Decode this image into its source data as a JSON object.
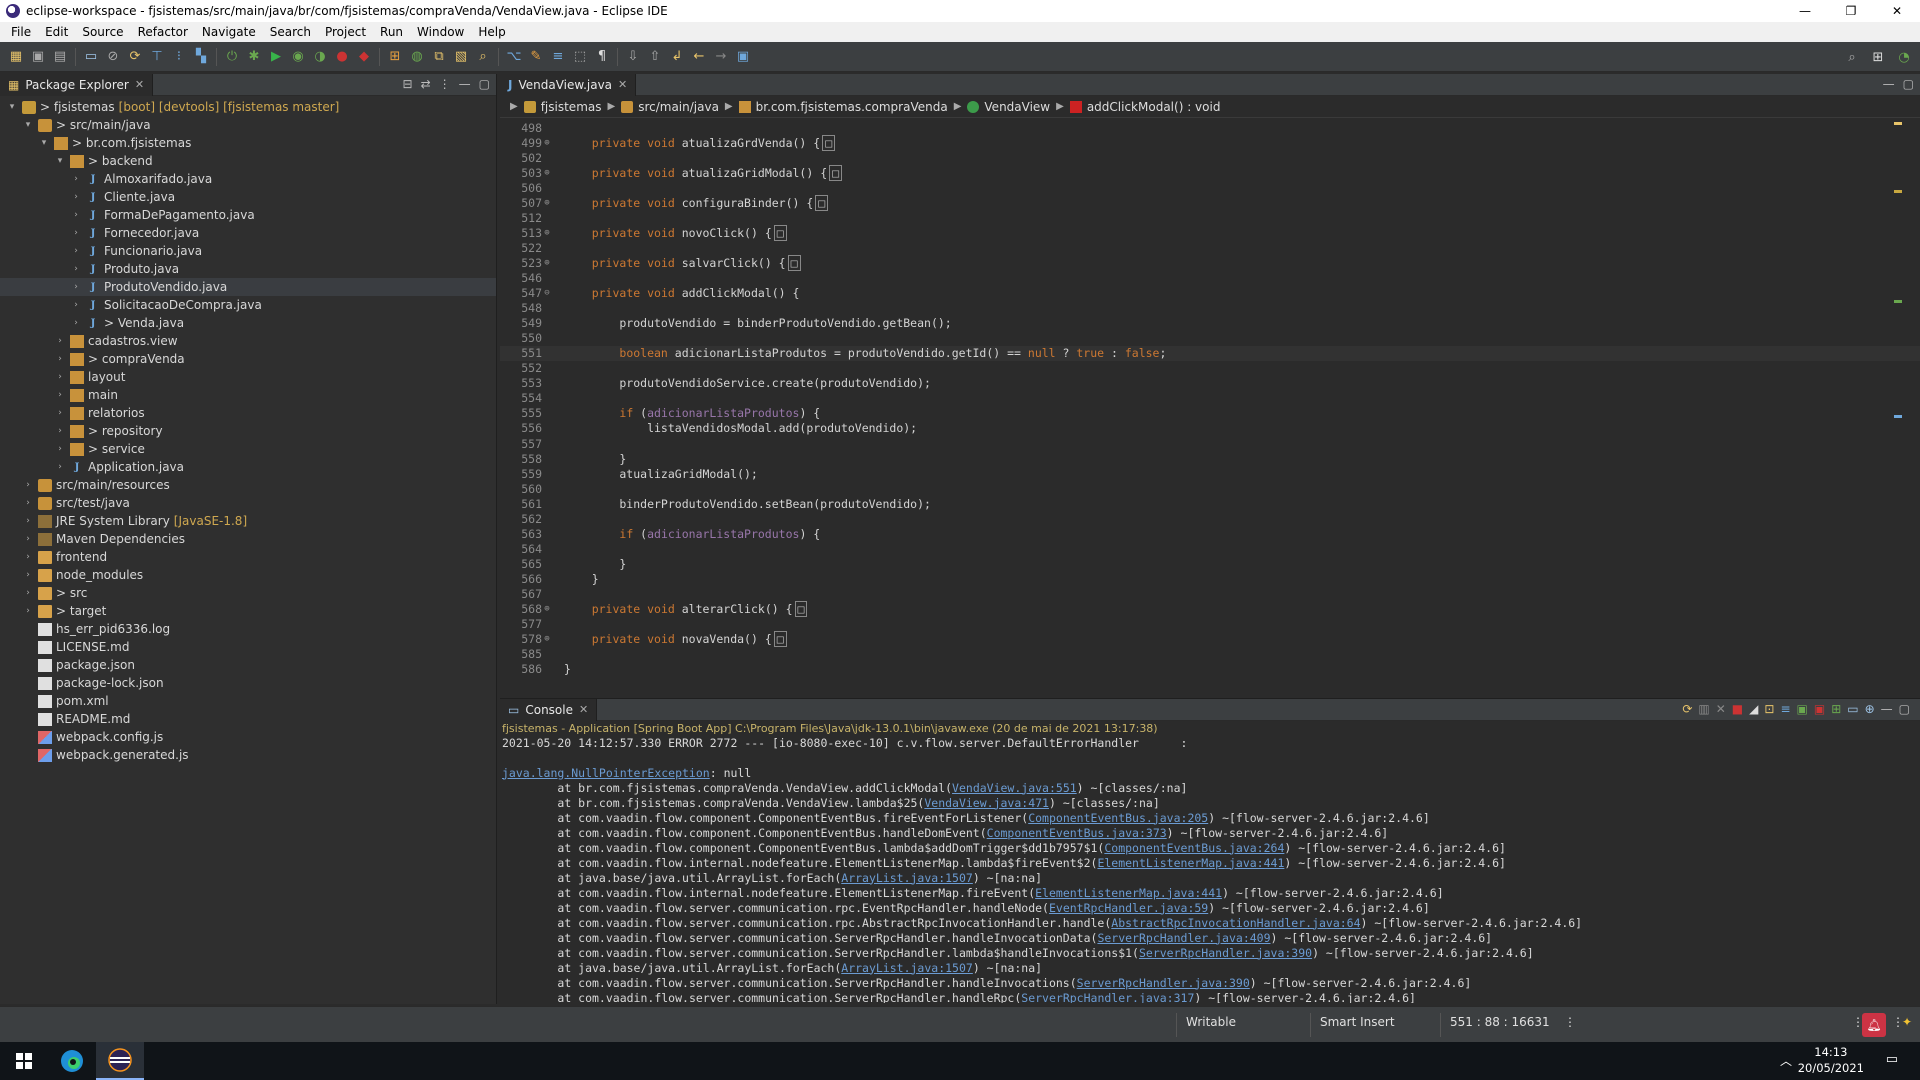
{
  "window": {
    "title": "eclipse-workspace - fjsistemas/src/main/java/br/com/fjsistemas/compraVenda/VendaView.java - Eclipse IDE",
    "controls": [
      "—",
      "❐",
      "✕"
    ]
  },
  "menu": [
    "File",
    "Edit",
    "Source",
    "Refactor",
    "Navigate",
    "Search",
    "Project",
    "Run",
    "Window",
    "Help"
  ],
  "explorer": {
    "tab_label": "Package Explorer",
    "tree": [
      {
        "depth": 0,
        "twisty": "▾",
        "icon": "project",
        "label": "> fjsistemas",
        "extra": "[boot] [devtools] [fjsistemas master]"
      },
      {
        "depth": 1,
        "twisty": "▾",
        "icon": "src",
        "label": "> src/main/java",
        "extra": ""
      },
      {
        "depth": 2,
        "twisty": "▾",
        "icon": "pkg",
        "label": "> br.com.fjsistemas",
        "extra": ""
      },
      {
        "depth": 3,
        "twisty": "▾",
        "icon": "pkg",
        "label": "> backend",
        "extra": ""
      },
      {
        "depth": 4,
        "twisty": "›",
        "icon": "java",
        "label": "Almoxarifado.java",
        "extra": ""
      },
      {
        "depth": 4,
        "twisty": "›",
        "icon": "java",
        "label": "Cliente.java",
        "extra": ""
      },
      {
        "depth": 4,
        "twisty": "›",
        "icon": "java",
        "label": "FormaDePagamento.java",
        "extra": ""
      },
      {
        "depth": 4,
        "twisty": "›",
        "icon": "java",
        "label": "Fornecedor.java",
        "extra": ""
      },
      {
        "depth": 4,
        "twisty": "›",
        "icon": "java",
        "label": "Funcionario.java",
        "extra": ""
      },
      {
        "depth": 4,
        "twisty": "›",
        "icon": "java",
        "label": "Produto.java",
        "extra": ""
      },
      {
        "depth": 4,
        "twisty": "›",
        "icon": "java",
        "label": "ProdutoVendido.java",
        "extra": "",
        "selected": true
      },
      {
        "depth": 4,
        "twisty": "›",
        "icon": "java",
        "label": "SolicitacaoDeCompra.java",
        "extra": ""
      },
      {
        "depth": 4,
        "twisty": "›",
        "icon": "java",
        "label": "> Venda.java",
        "extra": ""
      },
      {
        "depth": 3,
        "twisty": "›",
        "icon": "pkg",
        "label": "cadastros.view",
        "extra": ""
      },
      {
        "depth": 3,
        "twisty": "›",
        "icon": "pkg",
        "label": "> compraVenda",
        "extra": ""
      },
      {
        "depth": 3,
        "twisty": "›",
        "icon": "pkg",
        "label": "layout",
        "extra": ""
      },
      {
        "depth": 3,
        "twisty": "›",
        "icon": "pkg",
        "label": "main",
        "extra": ""
      },
      {
        "depth": 3,
        "twisty": "›",
        "icon": "pkg",
        "label": "relatorios",
        "extra": ""
      },
      {
        "depth": 3,
        "twisty": "›",
        "icon": "pkg",
        "label": "> repository",
        "extra": ""
      },
      {
        "depth": 3,
        "twisty": "›",
        "icon": "pkg",
        "label": "> service",
        "extra": ""
      },
      {
        "depth": 3,
        "twisty": "›",
        "icon": "java",
        "label": "Application.java",
        "extra": ""
      },
      {
        "depth": 1,
        "twisty": "›",
        "icon": "src",
        "label": "src/main/resources",
        "extra": ""
      },
      {
        "depth": 1,
        "twisty": "›",
        "icon": "src",
        "label": "src/test/java",
        "extra": ""
      },
      {
        "depth": 1,
        "twisty": "›",
        "icon": "lib",
        "label": "JRE System Library",
        "extra": "[JavaSE-1.8]"
      },
      {
        "depth": 1,
        "twisty": "›",
        "icon": "lib",
        "label": "Maven Dependencies",
        "extra": ""
      },
      {
        "depth": 1,
        "twisty": "›",
        "icon": "folder",
        "label": "frontend",
        "extra": ""
      },
      {
        "depth": 1,
        "twisty": "›",
        "icon": "folder",
        "label": "node_modules",
        "extra": ""
      },
      {
        "depth": 1,
        "twisty": "›",
        "icon": "folder",
        "label": "> src",
        "extra": ""
      },
      {
        "depth": 1,
        "twisty": "›",
        "icon": "folder",
        "label": "> target",
        "extra": ""
      },
      {
        "depth": 1,
        "twisty": "",
        "icon": "file",
        "label": "hs_err_pid6336.log",
        "extra": ""
      },
      {
        "depth": 1,
        "twisty": "",
        "icon": "file",
        "label": "LICENSE.md",
        "extra": ""
      },
      {
        "depth": 1,
        "twisty": "",
        "icon": "file",
        "label": "package.json",
        "extra": ""
      },
      {
        "depth": 1,
        "twisty": "",
        "icon": "file",
        "label": "package-lock.json",
        "extra": ""
      },
      {
        "depth": 1,
        "twisty": "",
        "icon": "file",
        "label": "pom.xml",
        "extra": ""
      },
      {
        "depth": 1,
        "twisty": "",
        "icon": "file",
        "label": "README.md",
        "extra": ""
      },
      {
        "depth": 1,
        "twisty": "",
        "icon": "web",
        "label": "webpack.config.js",
        "extra": ""
      },
      {
        "depth": 1,
        "twisty": "",
        "icon": "web",
        "label": "webpack.generated.js",
        "extra": ""
      }
    ]
  },
  "editor": {
    "tab_label": "VendaView.java",
    "breadcrumb": [
      "fjsistemas",
      "src/main/java",
      "br.com.fjsistemas.compraVenda",
      "VendaView",
      "addClickModal() : void"
    ],
    "lines": [
      {
        "n": "498",
        "fold": "",
        "code": ""
      },
      {
        "n": "499",
        "fold": "⊕",
        "code": "    <k>private</k> <k>void</k> atualizaGrdVenda() {<f>□</f>"
      },
      {
        "n": "502",
        "fold": "",
        "code": ""
      },
      {
        "n": "503",
        "fold": "⊕",
        "code": "    <k>private</k> <k>void</k> atualizaGridModal() {<f>□</f>"
      },
      {
        "n": "506",
        "fold": "",
        "code": ""
      },
      {
        "n": "507",
        "fold": "⊕",
        "code": "    <k>private</k> <k>void</k> configuraBinder() {<f>□</f>"
      },
      {
        "n": "512",
        "fold": "",
        "code": ""
      },
      {
        "n": "513",
        "fold": "⊕",
        "code": "    <k>private</k> <k>void</k> novoClick() {<f>□</f>"
      },
      {
        "n": "522",
        "fold": "",
        "code": ""
      },
      {
        "n": "523",
        "fold": "⊕",
        "code": "    <k>private</k> <k>void</k> salvarClick() {<f>□</f>"
      },
      {
        "n": "546",
        "fold": "",
        "code": ""
      },
      {
        "n": "547",
        "fold": "⊖",
        "code": "    <k>private</k> <k>void</k> addClickModal() {"
      },
      {
        "n": "548",
        "fold": "",
        "code": ""
      },
      {
        "n": "549",
        "fold": "",
        "code": "        produtoVendido = binderProdutoVendido.getBean();"
      },
      {
        "n": "550",
        "fold": "",
        "code": ""
      },
      {
        "n": "551",
        "fold": "",
        "code": "        <k>boolean</k> adicionarListaProdutos = produtoVendido.getId() == <k>null</k> ? <k>true</k> : <k>false</k>;",
        "current": true
      },
      {
        "n": "552",
        "fold": "",
        "code": ""
      },
      {
        "n": "553",
        "fold": "",
        "code": "        produtoVendidoService.create(produtoVendido);"
      },
      {
        "n": "554",
        "fold": "",
        "code": ""
      },
      {
        "n": "555",
        "fold": "",
        "code": "        <k>if</k> (<v>adicionarListaProdutos</v>) {"
      },
      {
        "n": "556",
        "fold": "",
        "code": "            listaVendidosModal.add(produtoVendido);"
      },
      {
        "n": "557",
        "fold": "",
        "code": ""
      },
      {
        "n": "558",
        "fold": "",
        "code": "        }"
      },
      {
        "n": "559",
        "fold": "",
        "code": "        atualizaGridModal();"
      },
      {
        "n": "560",
        "fold": "",
        "code": ""
      },
      {
        "n": "561",
        "fold": "",
        "code": "        binderProdutoVendido.setBean(produtoVendido);"
      },
      {
        "n": "562",
        "fold": "",
        "code": ""
      },
      {
        "n": "563",
        "fold": "",
        "code": "        <k>if</k> (<v>adicionarListaProdutos</v>) {"
      },
      {
        "n": "564",
        "fold": "",
        "code": ""
      },
      {
        "n": "565",
        "fold": "",
        "code": "        }"
      },
      {
        "n": "566",
        "fold": "",
        "code": "    }"
      },
      {
        "n": "567",
        "fold": "",
        "code": ""
      },
      {
        "n": "568",
        "fold": "⊕",
        "code": "    <k>private</k> <k>void</k> alterarClick() {<f>□</f>"
      },
      {
        "n": "577",
        "fold": "",
        "code": ""
      },
      {
        "n": "578",
        "fold": "⊕",
        "code": "    <k>private</k> <k>void</k> novaVenda() {<f>□</f>"
      },
      {
        "n": "585",
        "fold": "",
        "code": ""
      },
      {
        "n": "586",
        "fold": "",
        "code": "}"
      }
    ]
  },
  "console": {
    "tab_label": "Console",
    "launch_info": "fjsistemas - Application [Spring Boot App] C:\\Program Files\\Java\\jdk-13.0.1\\bin\\javaw.exe  (20 de mai de 2021 13:17:38)",
    "lines": [
      {
        "pre": "2021-05-20 14:12:57.330 ERROR 2772 --- [io-8080-exec-10] c.v.flow.server.DefaultErrorHandler      :",
        "link": "",
        "post": ""
      },
      {
        "pre": "",
        "link": "",
        "post": ""
      },
      {
        "pre": "",
        "link": "java.lang.NullPointerException",
        "post": ": null"
      },
      {
        "pre": "\tat br.com.fjsistemas.compraVenda.VendaView.addClickModal(",
        "link": "VendaView.java:551",
        "post": ") ~[classes/:na]"
      },
      {
        "pre": "\tat br.com.fjsistemas.compraVenda.VendaView.lambda$25(",
        "link": "VendaView.java:471",
        "post": ") ~[classes/:na]"
      },
      {
        "pre": "\tat com.vaadin.flow.component.ComponentEventBus.fireEventForListener(",
        "link": "ComponentEventBus.java:205",
        "post": ") ~[flow-server-2.4.6.jar:2.4.6]"
      },
      {
        "pre": "\tat com.vaadin.flow.component.ComponentEventBus.handleDomEvent(",
        "link": "ComponentEventBus.java:373",
        "post": ") ~[flow-server-2.4.6.jar:2.4.6]"
      },
      {
        "pre": "\tat com.vaadin.flow.component.ComponentEventBus.lambda$addDomTrigger$dd1b7957$1(",
        "link": "ComponentEventBus.java:264",
        "post": ") ~[flow-server-2.4.6.jar:2.4.6]"
      },
      {
        "pre": "\tat com.vaadin.flow.internal.nodefeature.ElementListenerMap.lambda$fireEvent$2(",
        "link": "ElementListenerMap.java:441",
        "post": ") ~[flow-server-2.4.6.jar:2.4.6]"
      },
      {
        "pre": "\tat java.base/java.util.ArrayList.forEach(",
        "link": "ArrayList.java:1507",
        "post": ") ~[na:na]"
      },
      {
        "pre": "\tat com.vaadin.flow.internal.nodefeature.ElementListenerMap.fireEvent(",
        "link": "ElementListenerMap.java:441",
        "post": ") ~[flow-server-2.4.6.jar:2.4.6]"
      },
      {
        "pre": "\tat com.vaadin.flow.server.communication.rpc.EventRpcHandler.handleNode(",
        "link": "EventRpcHandler.java:59",
        "post": ") ~[flow-server-2.4.6.jar:2.4.6]"
      },
      {
        "pre": "\tat com.vaadin.flow.server.communication.rpc.AbstractRpcInvocationHandler.handle(",
        "link": "AbstractRpcInvocationHandler.java:64",
        "post": ") ~[flow-server-2.4.6.jar:2.4.6]"
      },
      {
        "pre": "\tat com.vaadin.flow.server.communication.ServerRpcHandler.handleInvocationData(",
        "link": "ServerRpcHandler.java:409",
        "post": ") ~[flow-server-2.4.6.jar:2.4.6]"
      },
      {
        "pre": "\tat com.vaadin.flow.server.communication.ServerRpcHandler.lambda$handleInvocations$1(",
        "link": "ServerRpcHandler.java:390",
        "post": ") ~[flow-server-2.4.6.jar:2.4.6]"
      },
      {
        "pre": "\tat java.base/java.util.ArrayList.forEach(",
        "link": "ArrayList.java:1507",
        "post": ") ~[na:na]"
      },
      {
        "pre": "\tat com.vaadin.flow.server.communication.ServerRpcHandler.handleInvocations(",
        "link": "ServerRpcHandler.java:390",
        "post": ") ~[flow-server-2.4.6.jar:2.4.6]"
      },
      {
        "pre": "\tat com.vaadin.flow.server.communication.ServerRpcHandler.handleRpc(",
        "link": "ServerRpcHandler.java:317",
        "post": ") ~[flow-server-2.4.6.jar:2.4.6]"
      }
    ]
  },
  "status": {
    "writable": "Writable",
    "insert_mode": "Smart Insert",
    "position": "551 : 88 : 16631"
  },
  "taskbar": {
    "time": "14:13",
    "date": "20/05/2021"
  },
  "colors": {
    "keyword": "#cc7832",
    "field": "#9876aa",
    "link": "#6b9bd2",
    "launch_info": "#c8b46a"
  }
}
